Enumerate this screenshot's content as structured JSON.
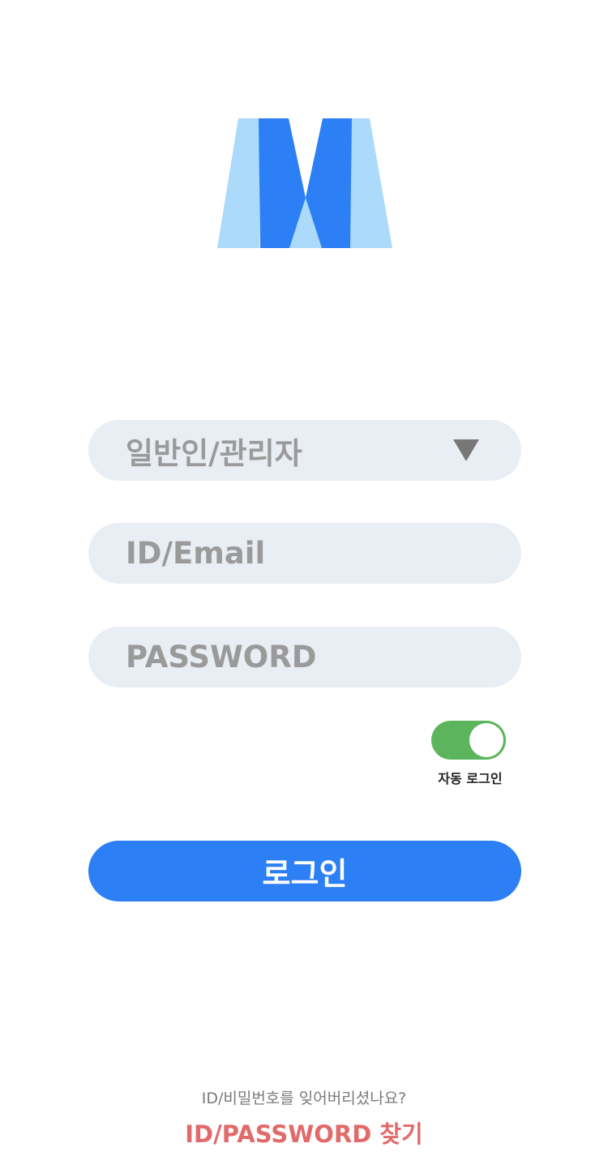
{
  "colors": {
    "primary": "#2d7ff5",
    "logo_light": "#abdafa",
    "field_bg": "#e8eef4",
    "toggle_on": "#5cb55c",
    "link": "#e26a6a"
  },
  "logo": {
    "icon": "m-logo-icon"
  },
  "form": {
    "user_type_select": {
      "value": "일반인/관리자",
      "icon": "triangle-down-icon"
    },
    "id_field": {
      "placeholder": "ID/Email"
    },
    "password_field": {
      "placeholder": "PASSWORD"
    },
    "auto_login": {
      "label": "자동 로그인",
      "enabled": true
    },
    "login_label": "로그인"
  },
  "footer": {
    "question": "ID/비밀번호를 잊어버리셨나요?",
    "find_link": "ID/PASSWORD 찾기"
  }
}
